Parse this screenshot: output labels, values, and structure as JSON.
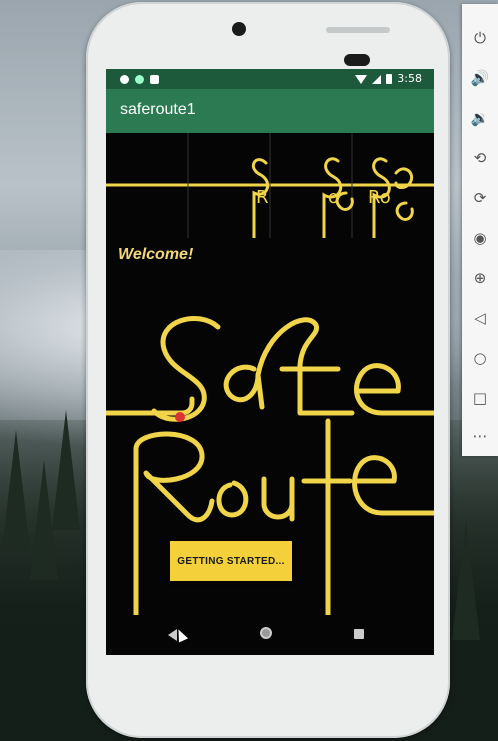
{
  "status_bar": {
    "time": "3:58"
  },
  "app_bar": {
    "title": "saferoute1"
  },
  "main": {
    "welcome_text": "Welcome!",
    "logo_line1": "Safe",
    "logo_line2": "Route",
    "start_button_label": "GETTING STARTED..."
  },
  "emulator_toolbar": {
    "icons": [
      "power-icon",
      "volume-up-icon",
      "volume-down-icon",
      "rotate-left-icon",
      "rotate-right-icon",
      "camera-icon",
      "zoom-icon",
      "back-icon",
      "home-icon",
      "overview-icon",
      "more-icon"
    ]
  },
  "colors": {
    "status_bar": "#1d5a3b",
    "app_bar": "#2b7a52",
    "logo_yellow": "#f0d44a",
    "button_yellow": "#f4d13a"
  }
}
